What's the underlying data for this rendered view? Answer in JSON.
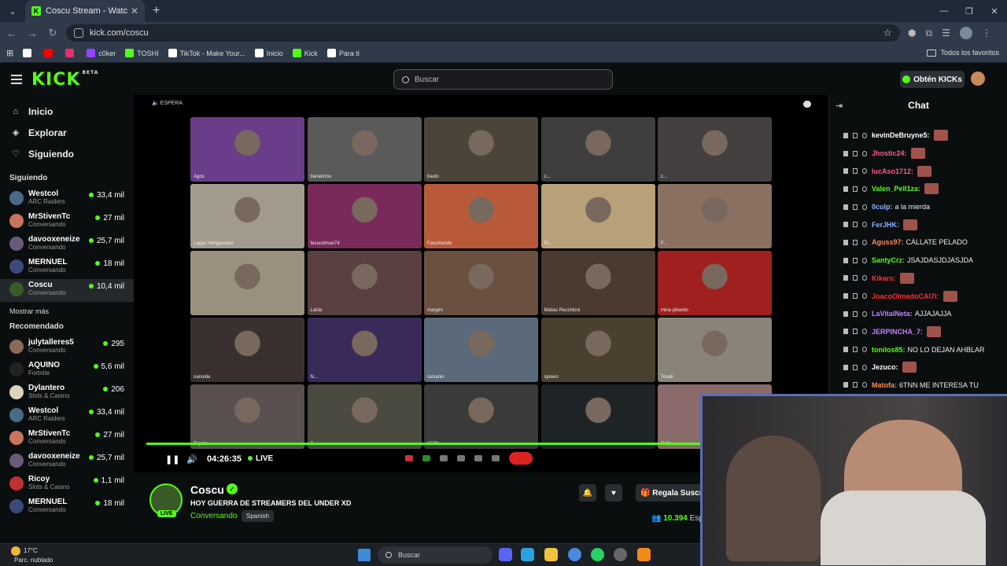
{
  "browser": {
    "tab_title": "Coscu Stream - Watch Live",
    "url": "kick.com/coscu",
    "bookmarks": [
      {
        "label": "",
        "icon": "x-icon",
        "color": "#ffffff"
      },
      {
        "label": "",
        "icon": "youtube-icon",
        "color": "#ff0000"
      },
      {
        "label": "",
        "icon": "instagram-icon",
        "color": "#e1306c"
      },
      {
        "label": "c0ker",
        "icon": "twitch-icon",
        "color": "#9146ff"
      },
      {
        "label": "TOSHI",
        "icon": "kick-icon",
        "color": "#53fc18"
      },
      {
        "label": "TikTok - Make Your...",
        "icon": "tiktok-icon",
        "color": "#ffffff"
      },
      {
        "label": "Inicio",
        "icon": "x-icon",
        "color": "#ffffff"
      },
      {
        "label": "Kick",
        "icon": "kick-icon",
        "color": "#53fc18"
      },
      {
        "label": "Para ti",
        "icon": "x-icon",
        "color": "#ffffff"
      }
    ],
    "all_favorites": "Todos los favoritos"
  },
  "header": {
    "logo": "KICK",
    "beta": "BETA",
    "search_placeholder": "Buscar",
    "get_kicks": "Obtén KICKs"
  },
  "sidebar": {
    "nav": [
      {
        "label": "Inicio",
        "icon": "home-icon"
      },
      {
        "label": "Explorar",
        "icon": "compass-icon"
      },
      {
        "label": "Siguiendo",
        "icon": "heart-icon"
      }
    ],
    "following_title": "Siguiendo",
    "following": [
      {
        "name": "Westcol",
        "category": "ARC Raiders",
        "viewers": "33,4 mil",
        "color": "#4a6a8a"
      },
      {
        "name": "MrStivenTc",
        "category": "Conversando",
        "viewers": "27 mil",
        "color": "#c9745c"
      },
      {
        "name": "davooxeneize",
        "category": "Conversando",
        "viewers": "25,7 mil",
        "color": "#6a5a7a"
      },
      {
        "name": "MERNUEL",
        "category": "Conversando",
        "viewers": "18 mil",
        "color": "#3a4a7a"
      },
      {
        "name": "Coscu",
        "category": "Conversando",
        "viewers": "10,4 mil",
        "color": "#3a5a2a"
      }
    ],
    "show_more": "Mostrar más",
    "recommended_title": "Recomendado",
    "recommended": [
      {
        "name": "julytalleres5",
        "category": "Conversando",
        "viewers": "295",
        "color": "#8a6a5a"
      },
      {
        "name": "AQUINO",
        "category": "Fortnite",
        "viewers": "5,6 mil",
        "color": "#222222"
      },
      {
        "name": "Dylantero",
        "category": "Slots & Casino",
        "viewers": "206",
        "color": "#ddd4c0"
      },
      {
        "name": "Westcol",
        "category": "ARC Raiders",
        "viewers": "33,4 mil",
        "color": "#4a6a8a"
      },
      {
        "name": "MrStivenTc",
        "category": "Conversando",
        "viewers": "27 mil",
        "color": "#c9745c"
      },
      {
        "name": "davooxeneize",
        "category": "Conversando",
        "viewers": "25,7 mil",
        "color": "#6a5a7a"
      },
      {
        "name": "Ricoy",
        "category": "Slots & Casino",
        "viewers": "1,1 mil",
        "color": "#c03030"
      },
      {
        "name": "MERNUEL",
        "category": "Conversando",
        "viewers": "18 mil",
        "color": "#3a4a7a"
      }
    ]
  },
  "player": {
    "status": "ESPERA",
    "elapsed": "04:26:35",
    "live": "LIVE",
    "progress": 0.84,
    "tiles": [
      {
        "label": "Agos",
        "color": "#6a3d8a"
      },
      {
        "label": "bananirou",
        "color": "#5a5a5a"
      },
      {
        "label": "baulo",
        "color": "#4a4538"
      },
      {
        "label": "c...",
        "color": "#3e3e3e"
      },
      {
        "label": "c...",
        "color": "#444040"
      },
      {
        "label": "Lagaz Hengarsitoo",
        "color": "#a39a8e"
      },
      {
        "label": "facucolman74",
        "color": "#7a2a5a"
      },
      {
        "label": "Faculriondo",
        "color": "#b85a3a"
      },
      {
        "label": "Fil...",
        "color": "#b8a078"
      },
      {
        "label": "F...",
        "color": "#8a7060"
      },
      {
        "label": "",
        "color": "#9a9080"
      },
      {
        "label": "Larita",
        "color": "#5a4040"
      },
      {
        "label": "margim",
        "color": "#6a5040"
      },
      {
        "label": "Matias Recchioni",
        "color": "#4a3a30"
      },
      {
        "label": "mina pibardo",
        "color": "#a02020"
      },
      {
        "label": "nanoide",
        "color": "#3a3030"
      },
      {
        "label": "N...",
        "color": "#3a2a5a"
      },
      {
        "label": "ramanin",
        "color": "#5a6a7a"
      },
      {
        "label": "spreen",
        "color": "#4a4030"
      },
      {
        "label": "Tonali",
        "color": "#8a8478"
      },
      {
        "label": "Topato",
        "color": "#5a5050"
      },
      {
        "label": "T...",
        "color": "#4a4a40"
      },
      {
        "label": "X6TN",
        "color": "#3a3a3a"
      },
      {
        "label": "...",
        "color": "#1e2426"
      },
      {
        "label": "CAS",
        "color": "#8a6a6a"
      }
    ]
  },
  "stream": {
    "name": "Coscu",
    "title": "HOY GUERRA DE STREAMERS DEL UNDER XD",
    "category": "Conversando",
    "language": "Spanish",
    "live_badge": "LIVE",
    "gift_button": "Regala Suscri",
    "viewers": "10.394",
    "viewers_suffix": "Esp"
  },
  "chat": {
    "title": "Chat",
    "messages": [
      {
        "user": "kevinDeBruyne5:",
        "text": "",
        "color": "#ffffff",
        "emote": true
      },
      {
        "user": "Jhostic24:",
        "text": "",
        "color": "#ff5a8a",
        "emote": true
      },
      {
        "user": "lucAso1712:",
        "text": "",
        "color": "#ff5a8a",
        "emote": true
      },
      {
        "user": "Valen_Pell1za:",
        "text": "",
        "color": "#53fc18",
        "emote": true
      },
      {
        "user": "0culp:",
        "text": "a la mierda",
        "color": "#8ab4ff",
        "emote": false
      },
      {
        "user": "FerJHK:",
        "text": "",
        "color": "#8ab4ff",
        "emote": true
      },
      {
        "user": "Aguss97:",
        "text": "CÁLLATE PELADO",
        "color": "#ff8a5a",
        "emote": false
      },
      {
        "user": "SantyCrz:",
        "text": "JSAJDASJDJASJDA",
        "color": "#53fc18",
        "emote": false
      },
      {
        "user": "Kikars:",
        "text": "",
        "color": "#ff3030",
        "emote": true
      },
      {
        "user": "JoacoOlmedoCAI7l:",
        "text": "",
        "color": "#ff3030",
        "emote": true
      },
      {
        "user": "LaVitalNeta:",
        "text": "AJJAJAJJA",
        "color": "#c080ff",
        "emote": false
      },
      {
        "user": "JERPINCHA_7:",
        "text": "",
        "color": "#c080ff",
        "emote": true
      },
      {
        "user": "tonilos85:",
        "text": "NO LO DEJAN AHBLAR",
        "color": "#53fc18",
        "emote": false
      },
      {
        "user": "Jezuco:",
        "text": "",
        "color": "#ffffff",
        "emote": true
      },
      {
        "user": "Matofa:",
        "text": "6TNN ME INTERESA TU",
        "color": "#ff8a5a",
        "emote": false
      }
    ]
  },
  "taskbar": {
    "temperature": "17°C",
    "weather": "Parc. nublado",
    "search": "Buscar"
  }
}
